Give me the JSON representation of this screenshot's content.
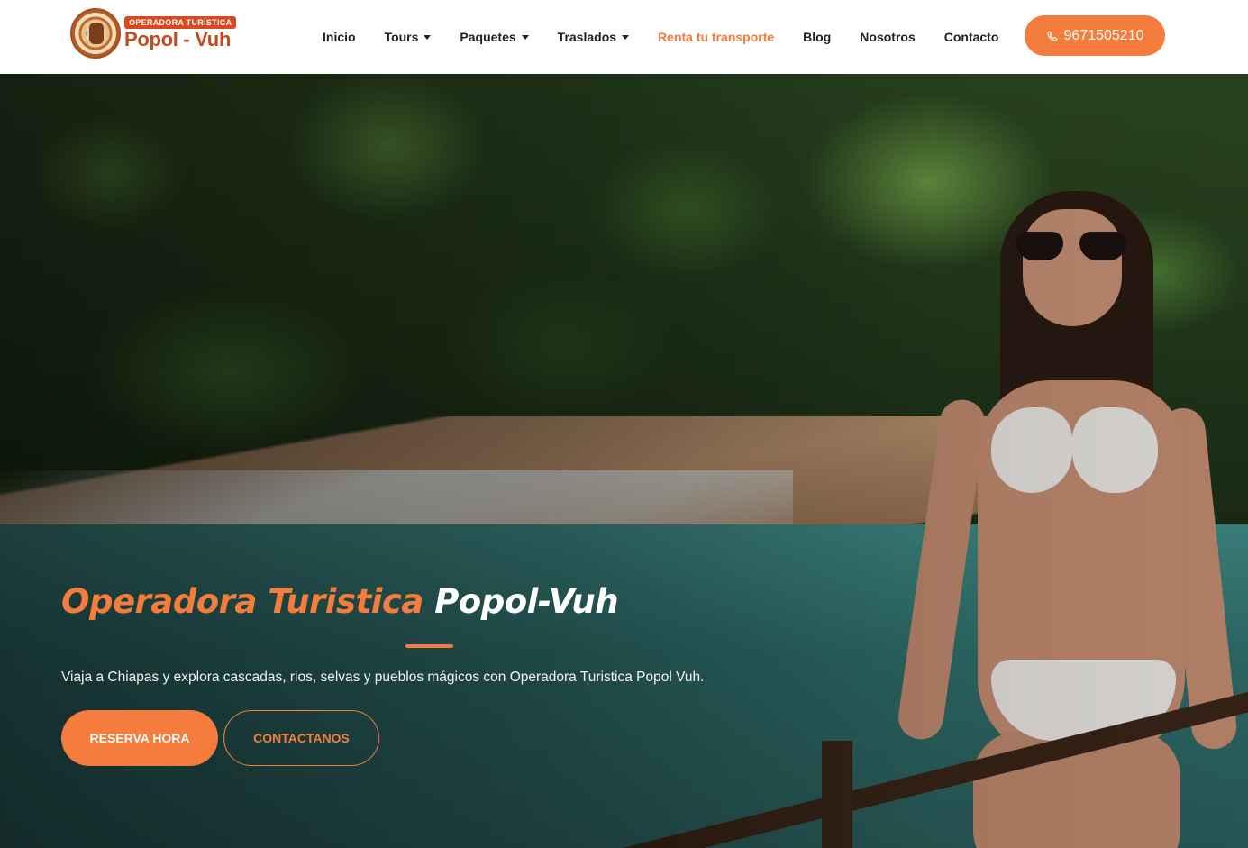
{
  "brand": {
    "tagline": "OPERADORA TURÍSTICA",
    "name": "Popol - Vuh"
  },
  "nav": {
    "items": [
      {
        "label": "Inicio"
      },
      {
        "label": "Tours"
      },
      {
        "label": "Paquetes"
      },
      {
        "label": "Traslados"
      },
      {
        "label": "Renta tu transporte"
      },
      {
        "label": "Blog"
      },
      {
        "label": "Nosotros"
      },
      {
        "label": "Contacto"
      }
    ],
    "phone": "9671505210"
  },
  "hero": {
    "title_accent": "Operadora Turistica",
    "title_name": "Popol-Vuh",
    "description": "Viaja a Chiapas y explora cascadas, rios, selvas y pueblos mágicos con Operadora Turistica Popol Vuh.",
    "primary_button": "RESERVA HORA",
    "secondary_button": "CONTACTANOS"
  },
  "colors": {
    "accent": "#f47c3c",
    "nav_text": "#222222",
    "brand_red": "#c14a1f"
  }
}
